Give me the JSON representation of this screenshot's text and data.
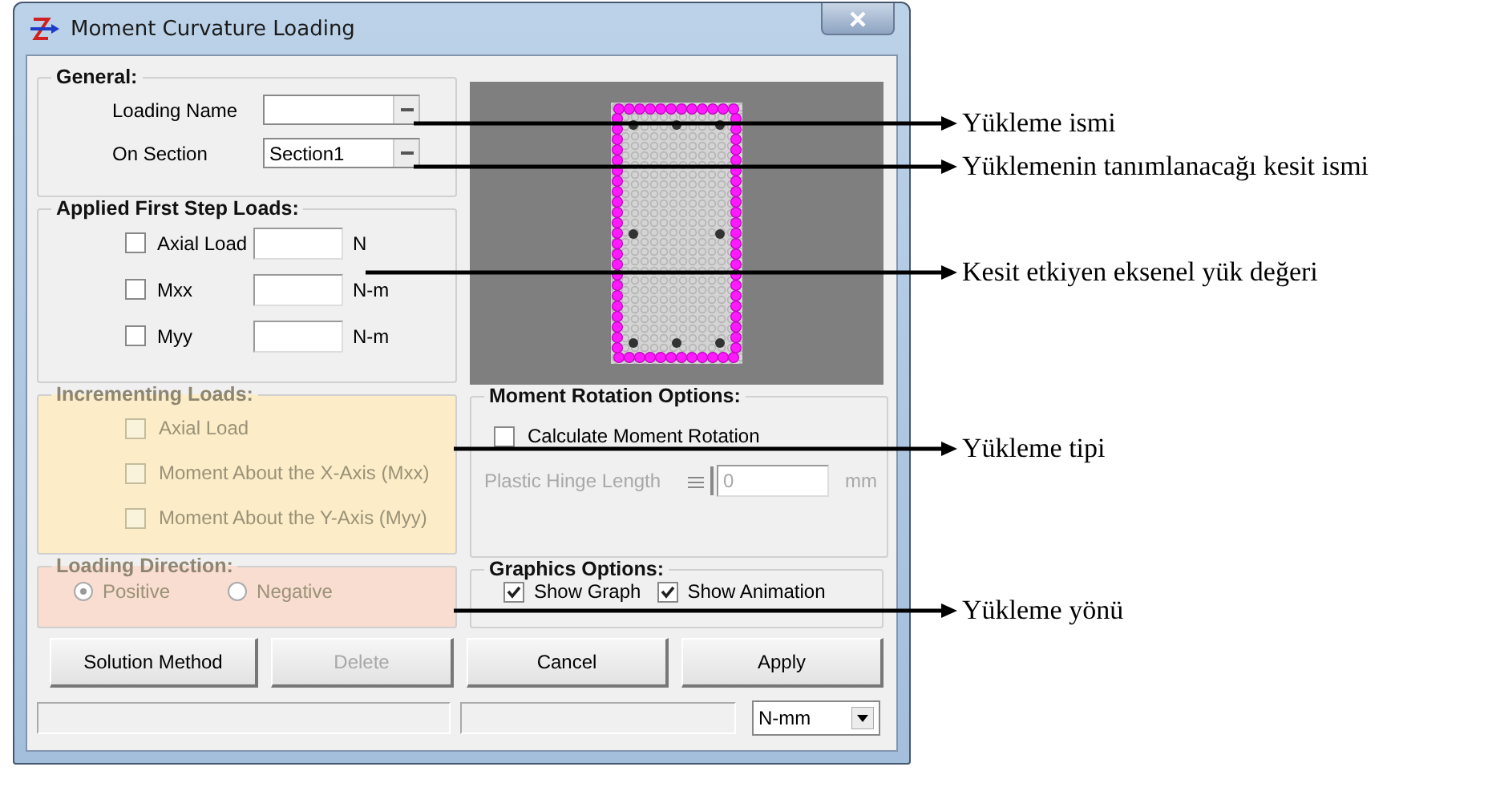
{
  "window": {
    "title": "Moment Curvature Loading"
  },
  "general": {
    "title": "General:",
    "fields": [
      {
        "label": "Loading Name"
      },
      {
        "label": "On Section",
        "value": "Section1"
      }
    ]
  },
  "applied_loads": {
    "title": "Applied First Step Loads:",
    "items": [
      {
        "label": "Axial Load",
        "checked": false,
        "unit": "N"
      },
      {
        "label": "Mxx",
        "checked": false,
        "unit": "N-m"
      },
      {
        "label": "Myy",
        "checked": false,
        "unit": "N-m"
      }
    ]
  },
  "incrementing_loads": {
    "title": "Incrementing Loads:",
    "disabled": true,
    "items": [
      {
        "label": "Axial Load",
        "checked": false
      },
      {
        "label": "Moment About the X-Axis (Mxx)",
        "checked": false
      },
      {
        "label": "Moment About the Y-Axis (Myy)",
        "checked": false
      }
    ]
  },
  "loading_direction": {
    "title": "Loading Direction:",
    "disabled": true,
    "options": [
      {
        "label": "Positive",
        "selected": true
      },
      {
        "label": "Negative",
        "selected": false
      }
    ]
  },
  "moment_rotation": {
    "title": "Moment Rotation Options:",
    "calculate": {
      "label": "Calculate Moment Rotation",
      "checked": false
    },
    "hinge": {
      "label": "Plastic Hinge Length",
      "value": "0",
      "unit": "mm",
      "disabled": true
    }
  },
  "graphics": {
    "title": "Graphics Options:",
    "options": [
      {
        "label": "Show Graph",
        "checked": true
      },
      {
        "label": "Show Animation",
        "checked": true
      }
    ]
  },
  "buttons": [
    {
      "label": "Solution Method",
      "disabled": false
    },
    {
      "label": "Delete",
      "disabled": true
    },
    {
      "label": "Cancel",
      "disabled": false
    },
    {
      "label": "Apply",
      "disabled": false
    }
  ],
  "status_bar": {
    "units": "N-mm"
  },
  "annotations": [
    {
      "text": "Yükleme ismi"
    },
    {
      "text": "Yüklemenin tanımlanacağı kesit ismi"
    },
    {
      "text": "Kesit etkiyen eksenel yük değeri"
    },
    {
      "text": "Yükleme tipi"
    },
    {
      "text": "Yükleme yönü"
    }
  ]
}
